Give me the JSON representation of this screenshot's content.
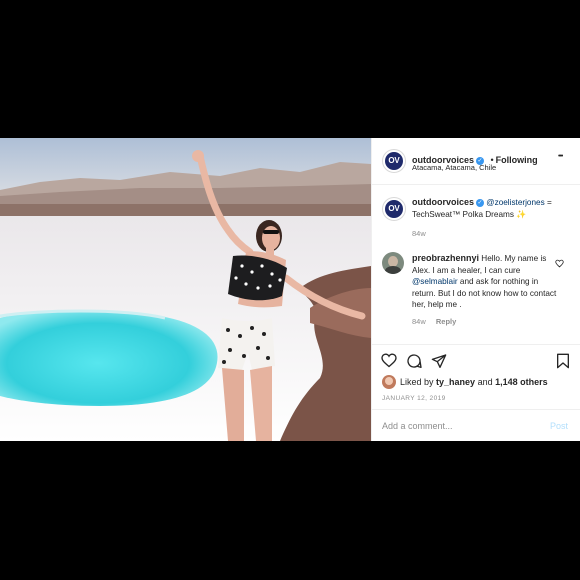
{
  "post": {
    "author": "outdoorvoices",
    "avatar_text": "OV",
    "verified_glyph": "✓",
    "separator": "•",
    "follow_label": "Following",
    "location": "Atacama, Atacama, Chile",
    "more_glyph": "•••"
  },
  "caption": {
    "author": "outdoorvoices",
    "mention": "@zoelisterjones",
    "text": "= TechSweat™ Polka Dreams",
    "emoji": "✨",
    "age": "84w"
  },
  "comment": {
    "author": "preobrazhennyi",
    "text_before": "Hello. My name is Alex. I am a healer, I can cure",
    "mention": "@selmablair",
    "text_after": "and ask for nothing in return. But I do not know how to contact her, help me .",
    "age": "84w",
    "reply_label": "Reply"
  },
  "likes": {
    "prefix": "Liked by",
    "user": "ty_haney",
    "and": "and",
    "count_text": "1,148 others",
    "date": "JANUARY 12, 2019"
  },
  "add_comment": {
    "placeholder": "Add a comment...",
    "post_label": "Post"
  },
  "colors": {
    "verified": "#3897f0",
    "link": "#00376b",
    "post_button": "#b2dffc",
    "lagoon": "#3fd7e0"
  }
}
